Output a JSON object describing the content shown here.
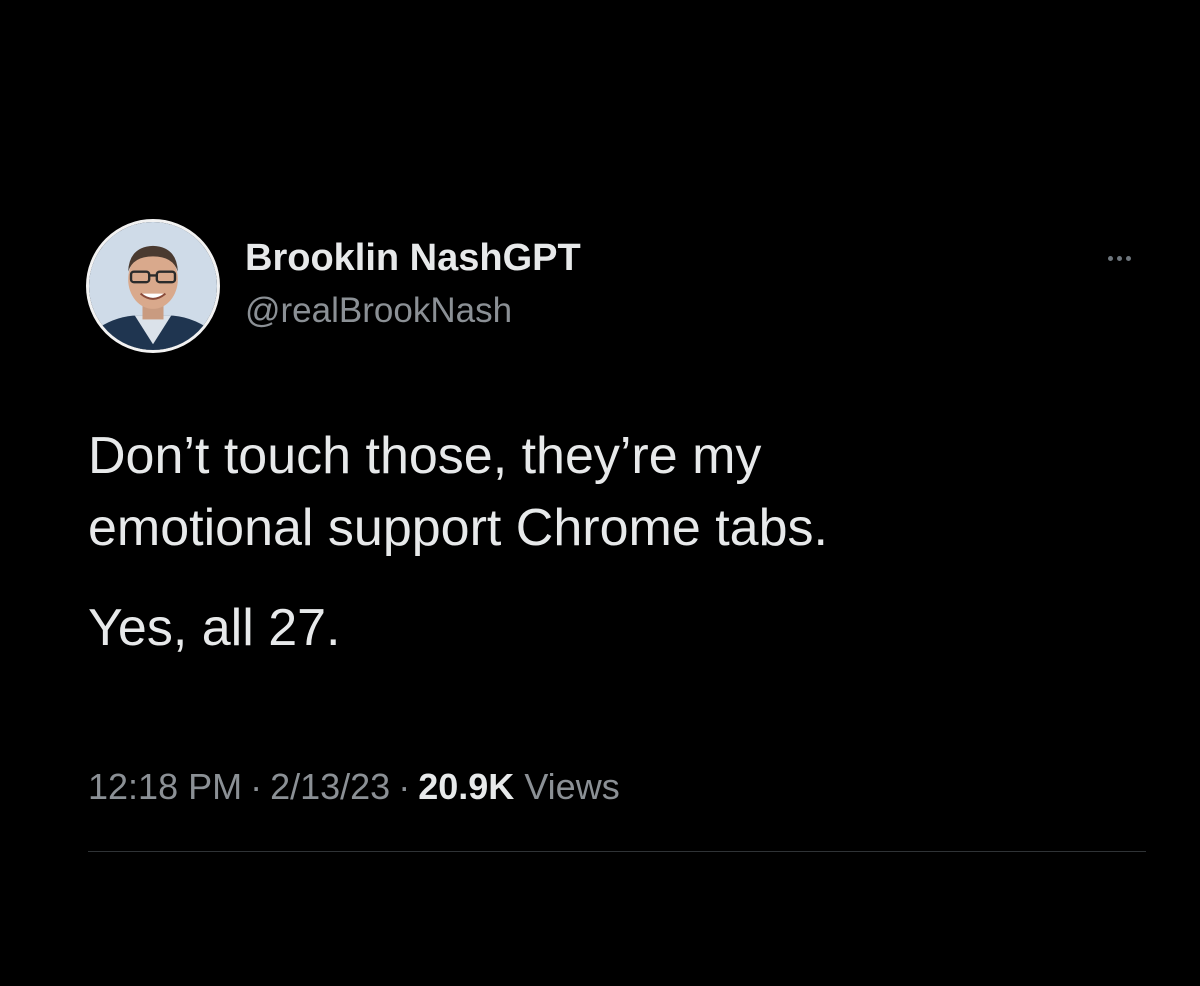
{
  "tweet": {
    "author": {
      "display_name": "Brooklin NashGPT",
      "handle": "@realBrookNash",
      "avatar_icon": "profile-photo"
    },
    "more_icon": "more-options-icon",
    "text": {
      "paragraph_1": "Don’t touch those, they’re my\nemotional support Chrome tabs.",
      "paragraph_2": "Yes, all 27."
    },
    "meta": {
      "time": "12:18 PM",
      "separator": "·",
      "date": "2/13/23",
      "views_count": "20.9K",
      "views_label": "Views"
    }
  },
  "colors": {
    "background": "#000000",
    "primary_text": "#e7e9ea",
    "secondary_text": "#8b9095",
    "divider": "#2f3336"
  }
}
